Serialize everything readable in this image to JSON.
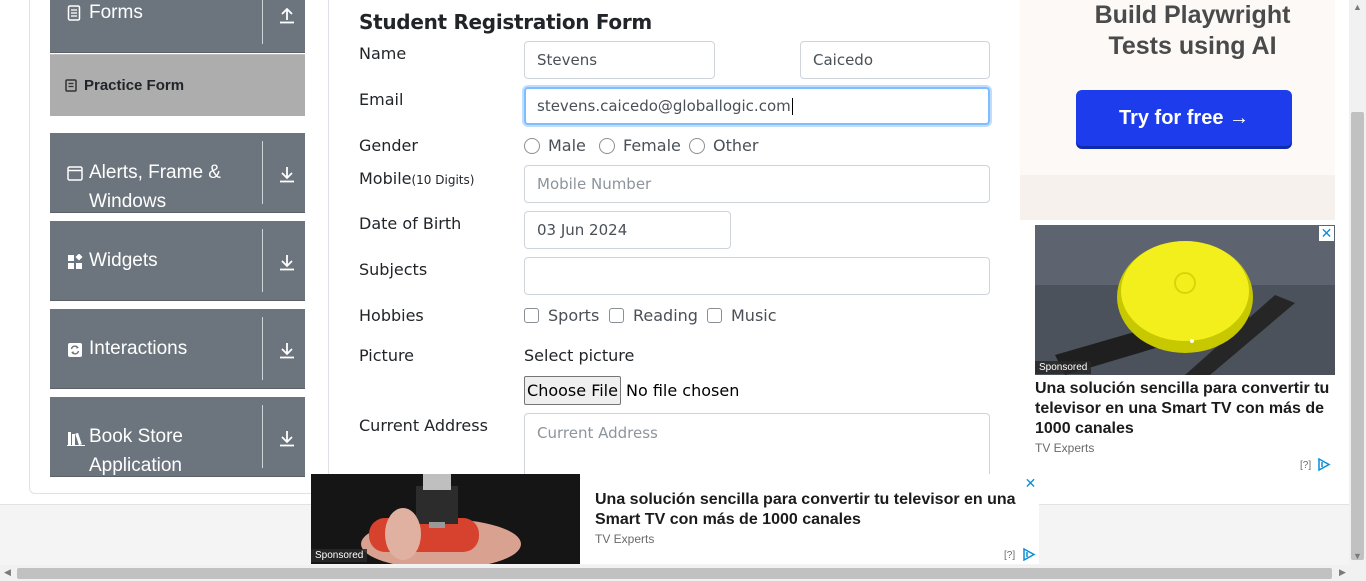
{
  "sidebar": {
    "forms": {
      "label": "Forms"
    },
    "practice_form": {
      "label": "Practice Form"
    },
    "groups": [
      {
        "label": "Alerts, Frame & Windows"
      },
      {
        "label": "Widgets"
      },
      {
        "label": "Interactions"
      },
      {
        "label": "Book Store Application"
      }
    ]
  },
  "form": {
    "title": "Student Registration Form",
    "name_label": "Name",
    "first_name": "Stevens",
    "last_name": "Caicedo",
    "email_label": "Email",
    "email": "stevens.caicedo@globallogic.com",
    "gender_label": "Gender",
    "gender_options": [
      "Male",
      "Female",
      "Other"
    ],
    "mobile_label": "Mobile",
    "mobile_hint": "(10 Digits)",
    "mobile_placeholder": "Mobile Number",
    "dob_label": "Date of Birth",
    "dob": "03 Jun 2024",
    "subjects_label": "Subjects",
    "subjects_value": "",
    "hobbies_label": "Hobbies",
    "hobbies_options": [
      "Sports",
      "Reading",
      "Music"
    ],
    "picture_label": "Picture",
    "select_picture": "Select picture",
    "choose_file": "Choose File",
    "no_file": "No file chosen",
    "address_label": "Current Address",
    "address_placeholder": "Current Address"
  },
  "ads": {
    "top": {
      "headline": "Build Playwright Tests using AI",
      "cta": "Try for free →"
    },
    "right": {
      "sponsored": "Sponsored",
      "headline": "Una solución sencilla para convertir tu televisor en una Smart TV con más de 1000 canales",
      "source": "TV Experts",
      "adchoice": "[?]"
    },
    "bottom": {
      "sponsored": "Sponsored",
      "headline": "Una solución sencilla para convertir tu televisor en una Smart TV con más de 1000 canales",
      "source": "TV Experts",
      "adchoice": "[?]"
    }
  },
  "colors": {
    "sidebar_group": "#6c757d",
    "active_item": "#adadad",
    "focus_border": "#80bdff",
    "cta_blue": "#1d3ded"
  }
}
